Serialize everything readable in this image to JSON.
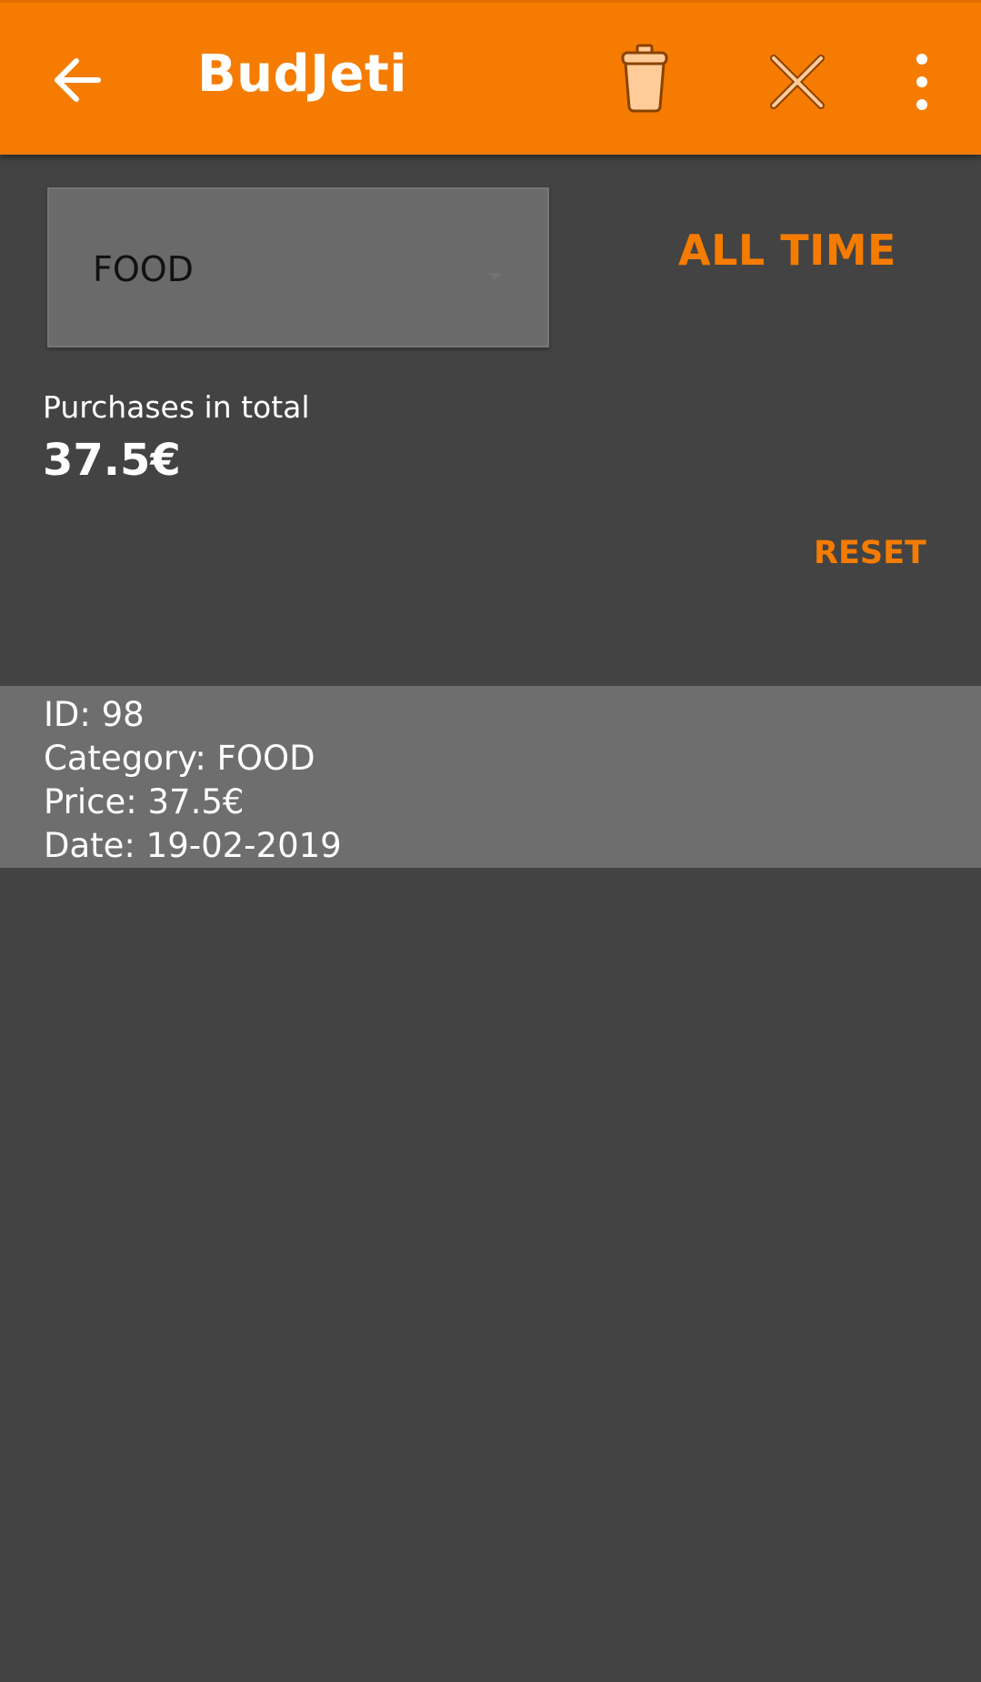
{
  "app": {
    "title": "BudJeti"
  },
  "toolbar": {
    "back_icon": "arrow-left-icon",
    "delete_icon": "trash-can-icon",
    "close_icon": "close-x-icon",
    "overflow_icon": "more-vertical-icon"
  },
  "filter": {
    "category_value": "FOOD",
    "period_label": "ALL TIME"
  },
  "summary": {
    "label": "Purchases in total",
    "value": "37.5€",
    "reset_label": "RESET"
  },
  "purchases": [
    {
      "id_line": "ID: 98",
      "category_line": "Category: FOOD",
      "price_line": "Price: 37.5€",
      "date_line": "Date: 19-02-2019"
    }
  ],
  "colors": {
    "accent": "#F57C00",
    "background": "#434343",
    "row_background": "#6E6E6E",
    "spinner_background": "#6A6A6A"
  }
}
